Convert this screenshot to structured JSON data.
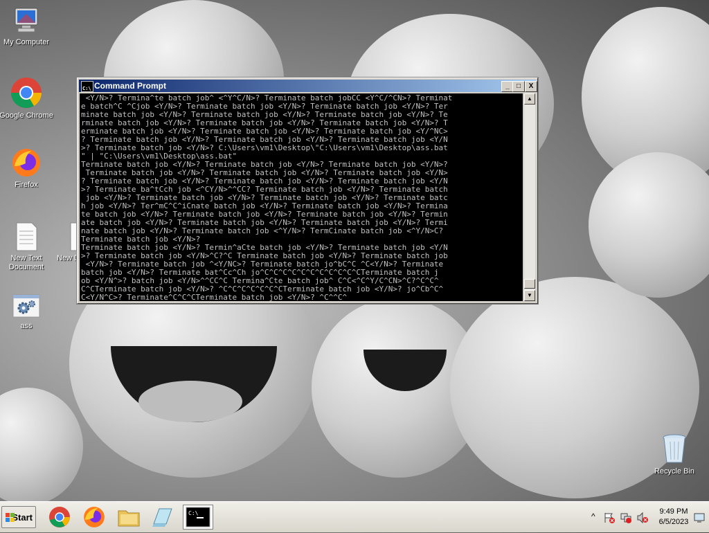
{
  "desktop": {
    "icons": [
      {
        "label": "My Computer"
      },
      {
        "label": "Google Chrome"
      },
      {
        "label": "Firefox"
      },
      {
        "label": "New Text Document"
      },
      {
        "label": "New Docum"
      },
      {
        "label": "ass"
      },
      {
        "label": "Recycle Bin"
      }
    ]
  },
  "window": {
    "title": "Command Prompt",
    "minimize": "_",
    "maximize": "□",
    "close": "X",
    "lines": [
      " <Y/N>? Termina^te batch job^ <^Y^C/N>? Terminate batch jobCC <Y^C/^CN>? Terminat",
      "e batch^C ^Cjob <Y/N>? Terminate batch job <Y/N>? Terminate batch job <Y/N>? Ter",
      "minate batch job <Y/N>? Terminate batch job <Y/N>? Terminate batch job <Y/N>? Te",
      "rminate batch job <Y/N>? Terminate batch job <Y/N>? Terminate batch job <Y/N>? T",
      "erminate batch job <Y/N>? Terminate batch job <Y/N>? Terminate batch job <Y/^NC>",
      "? Terminate batch job <Y/N>? Terminate batch job <Y/N>? Terminate batch job <Y/N",
      ">? Terminate batch job <Y/N>? C:\\Users\\vm1\\Desktop\\\"C:\\Users\\vm1\\Desktop\\ass.bat",
      "\" | \"C:\\Users\\vm1\\Desktop\\ass.bat\"",
      "Terminate batch job <Y/N>? Terminate batch job <Y/N>? Terminate batch job <Y/N>?",
      " Terminate batch job <Y/N>? Terminate batch job <Y/N>? Terminate batch job <Y/N>",
      "? Terminate batch job <Y/N>? Terminate batch job <Y/N>? Terminate batch job <Y/N",
      ">? Terminate ba^tCch job <^CY/N>^^CC? Terminate batch job <Y/N>? Terminate batch",
      " job <Y/N>? Terminate batch job <Y/N>? Terminate batch job <Y/N>? Terminate batc",
      "h job <Y/N>? Ter^mC^C^iCnate batch job <Y/N>? Terminate batch job <Y/N>? Termina",
      "te batch job <Y/N>? Terminate batch job <Y/N>? Terminate batch job <Y/N>? Termin",
      "ate batch job <Y/N>? Terminate batch job <Y/N>? Terminate batch job <Y/N>? Termi",
      "nate batch job <Y/N>? Terminate batch job <^Y/N>? TermCinate batch job <^Y/N>C? ",
      "Terminate batch job <Y/N>?",
      "Terminate batch job <Y/N>? Termin^aCte batch job <Y/N>? Terminate batch job <Y/N",
      ">? Terminate batch job <Y/N>^C?^C Terminate batch job <Y/N>? Terminate batch job",
      " <Y/N>? Terminate batch job ^<Y/NC>? Terminate batch jo^bC^C ^C<Y/N>? Terminate ",
      "batch job <Y/N>? Terminate bat^Cc^Ch jo^C^C^C^C^C^C^C^C^C^C^CTerminate batch j",
      "ob <Y/N^>? batch job <Y/N>^^CC^C Termina^Cte batch job^ C^C<^C^Y/C^CN>^C?^C^C^",
      "C^CTerminate batch job <Y/N>? ^C^C^C^C^C^C^CTerminate batch job <Y/N>? jo^Cb^C^",
      "C<Y/N^C>? Terminate^C^C^CTerminate batch job <Y/N>? ^C^^C^"
    ]
  },
  "taskbar": {
    "start_label": "Start",
    "time": "9:49 PM",
    "date": "6/5/2023",
    "tray_expand": "^"
  },
  "colors": {
    "title_bar": "#0a246a",
    "console_bg": "#000000",
    "console_fg": "#c0c0c0"
  }
}
